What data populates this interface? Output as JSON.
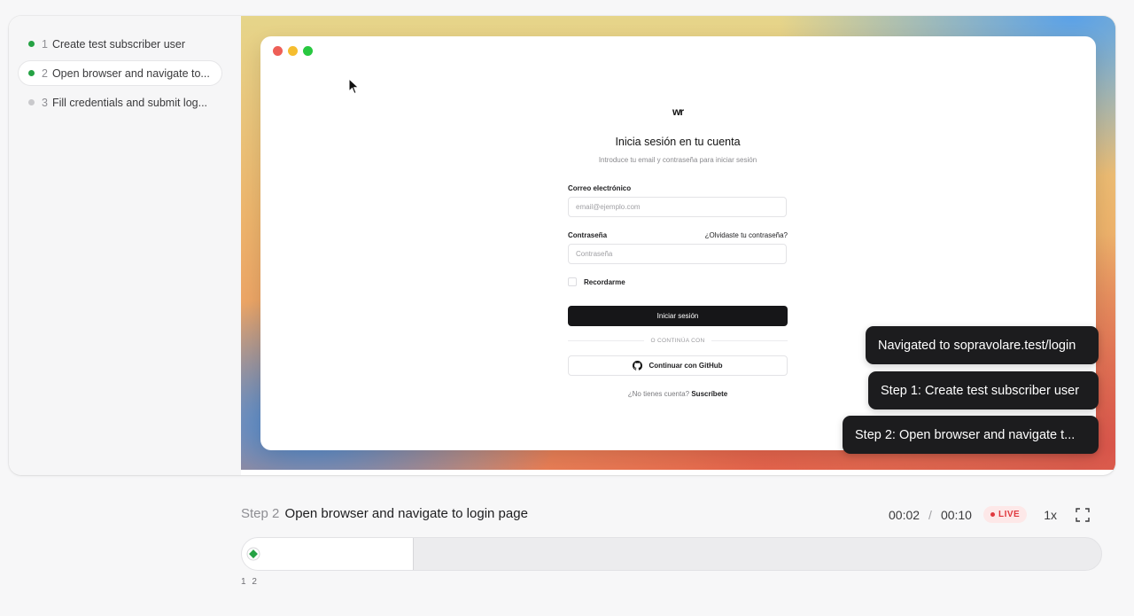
{
  "steps": [
    {
      "num": "1",
      "label": "Create test subscriber user",
      "status": "done"
    },
    {
      "num": "2",
      "label": "Open browser and navigate to...",
      "status": "done"
    },
    {
      "num": "3",
      "label": "Fill credentials and submit log...",
      "status": "pending"
    }
  ],
  "login": {
    "logo": "wr",
    "title": "Inicia sesión en tu cuenta",
    "subtitle": "Introduce tu email y contraseña para iniciar sesión",
    "email_label": "Correo electrónico",
    "email_placeholder": "email@ejemplo.com",
    "password_label": "Contraseña",
    "forgot_link": "¿Olvidaste tu contraseña?",
    "password_placeholder": "Contraseña",
    "remember_label": "Recordarme",
    "submit_label": "Iniciar sesión",
    "divider_text": "O CONTINÚA CON",
    "github_label": "Continuar con GitHub",
    "signup_prompt": "¿No tienes cuenta?",
    "signup_link": "Suscríbete"
  },
  "toasts": [
    "Navigated to sopravolare.test/login",
    "Step 1: Create test subscriber user",
    "Step 2: Open browser and navigate t..."
  ],
  "player": {
    "step_tag": "Step 2",
    "step_title": "Open browser and navigate to login page",
    "current_time": "00:02",
    "time_separator": "/",
    "total_time": "00:10",
    "live_label": "LIVE",
    "speed": "1x",
    "tick_labels": "1 2",
    "progress": 0.2
  },
  "colors": {
    "done": "#25a244",
    "pending": "#c9c9cc",
    "live": "#e0383e",
    "toast_bg": "#1c1c1e"
  },
  "icons": [
    "cursor-icon",
    "github-icon",
    "fullscreen-icon",
    "step-marker-icon"
  ]
}
